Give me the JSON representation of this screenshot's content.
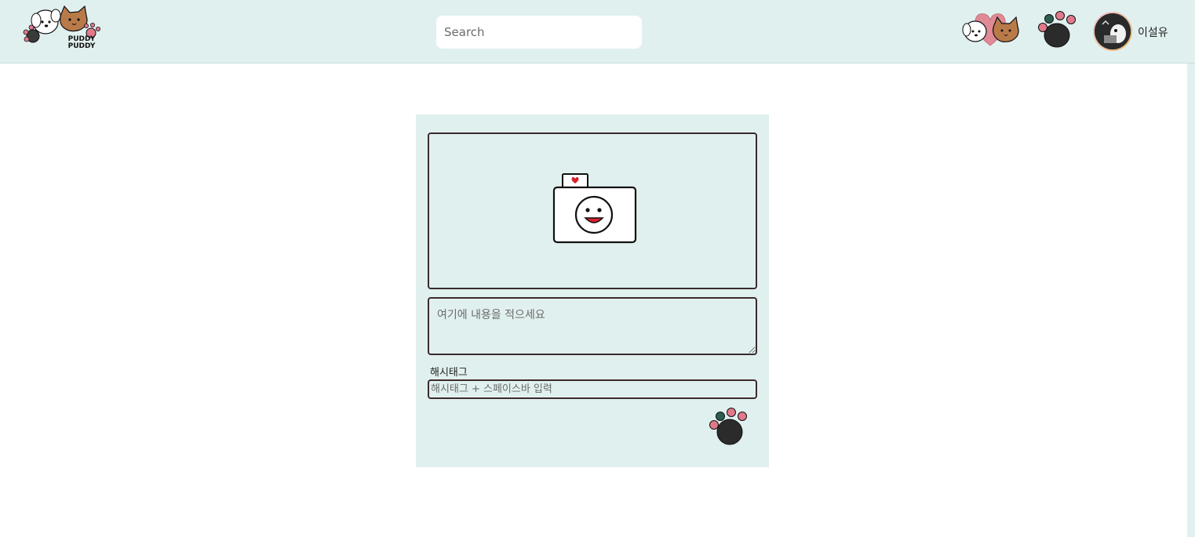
{
  "header": {
    "logo_text_line1": "PUDDY",
    "logo_text_line2": "PUDDY",
    "search": {
      "placeholder": "Search",
      "value": ""
    },
    "pets_icon": "dog-cat-heart-icon",
    "paw_icon": "paw-icon",
    "username": "이설유"
  },
  "post_form": {
    "photo_icon": "camera-icon",
    "content": {
      "placeholder": "여기에 내용을 적으세요",
      "value": ""
    },
    "hashtag_label": "해시태그",
    "hashtag": {
      "placeholder": "해시태그 + 스페이스바 입력",
      "value": ""
    },
    "submit_icon": "paw-submit-icon"
  },
  "colors": {
    "header_bg": "#e0f0ef",
    "card_bg": "#e0f0ef",
    "border": "#3b2a2e",
    "paw_pink": "#e07a8a",
    "paw_green": "#2e5e52",
    "paw_dark": "#2b2b2b"
  }
}
